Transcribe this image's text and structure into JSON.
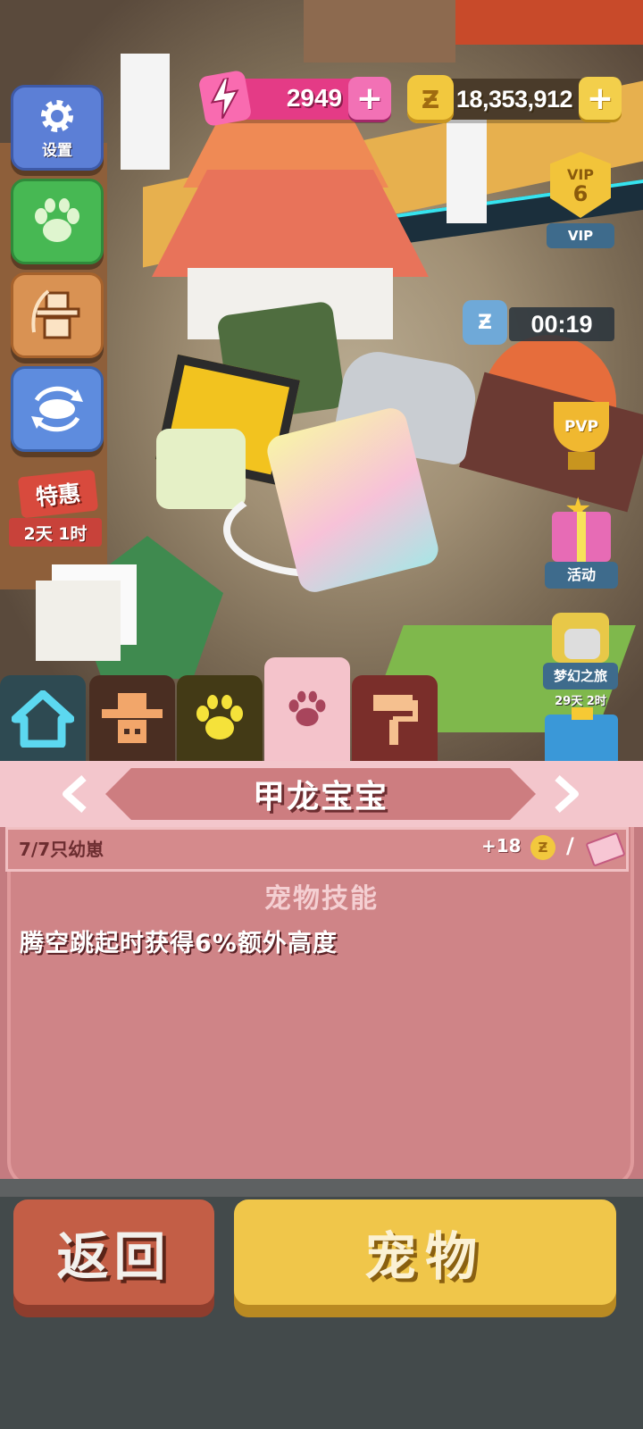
{
  "hud": {
    "energy_value": "2949",
    "energy_plus": "+",
    "coin_symbol": "Ƶ",
    "coin_value": "18,353,912",
    "coin_plus": "+"
  },
  "left_menu": {
    "settings_label": "设置",
    "special_offer_label": "特惠",
    "special_offer_timer": "2天 1时"
  },
  "right_menu": {
    "vip_badge_title": "VIP",
    "vip_level": "6",
    "vip_label": "VIP",
    "cooldown_icon_symbol": "Ƶ",
    "cooldown_time": "00:19",
    "pvp_label": "PVP",
    "activity_label": "活动",
    "dream_trip_label": "梦幻之旅",
    "dream_trip_timer": "29天 2时"
  },
  "tabs": [
    {
      "name": "home",
      "icon": "house-icon"
    },
    {
      "name": "hunter",
      "icon": "cowboy-hat-icon"
    },
    {
      "name": "animals",
      "icon": "paw-icon"
    },
    {
      "name": "pets",
      "icon": "paw-icon",
      "selected": true
    },
    {
      "name": "decorate",
      "icon": "paint-roller-icon"
    }
  ],
  "pet_panel": {
    "pet_name": "甲龙宝宝",
    "baby_count": "7/7只幼崽",
    "reward": "+18",
    "reward_coin": "Ƶ",
    "separator": "/",
    "skill_title": "宠物技能",
    "skill_description": "腾空跳起时获得6%额外高度"
  },
  "actions": {
    "back_label": "返回",
    "pet_label": "宠物"
  },
  "colors": {
    "panel_pink": "#cf8487",
    "header_pink": "#f3c6cc",
    "energy_pink": "#e43b86",
    "coin_gold": "#f2c83e",
    "back_red": "#c35e46",
    "pet_yellow": "#f0c64a"
  }
}
